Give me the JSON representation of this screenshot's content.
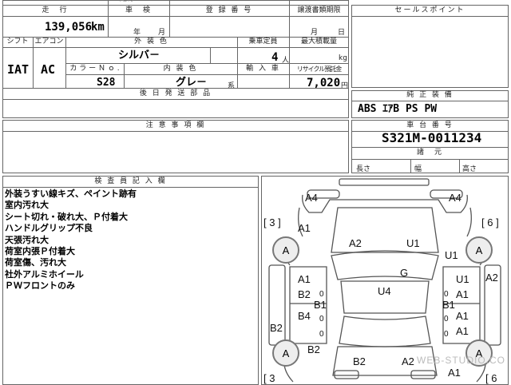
{
  "top_cut_label": "走行",
  "mileage": {
    "label": "走　行",
    "value": "139,056",
    "unit": "km"
  },
  "shaken": {
    "label": "車　検",
    "year_unit": "年",
    "month_unit": "月"
  },
  "registration": {
    "label": "登 録 番 号"
  },
  "transfer": {
    "label": "譲渡書類期限",
    "month_unit": "月",
    "day_unit": "日"
  },
  "sales_point": {
    "label": "セールスポイント"
  },
  "shift": {
    "label": "シフト",
    "value": "IAT"
  },
  "aircon": {
    "label": "エアコン",
    "value": "AC"
  },
  "exterior_color": {
    "label": "外 装 色",
    "value": "シルバ－"
  },
  "capacity": {
    "label": "乗車定員",
    "value": "4",
    "unit": "人"
  },
  "max_load": {
    "label": "最大積載量",
    "unit": "kg"
  },
  "color_no": {
    "label": "カ ラ ー Ｎ ｏ .",
    "value": "S28"
  },
  "interior_color": {
    "label": "内 装 色",
    "value": "グレ－",
    "suffix": "系"
  },
  "import": {
    "label": "輸 入 車"
  },
  "recycle": {
    "label": "リサイクル預託金",
    "value": "7,020",
    "unit": "円"
  },
  "later_items": {
    "label": "後 日 発 送 部 品"
  },
  "factory_options": {
    "label": "純 正 装 備",
    "value": "ABS ｴｱB PS PW"
  },
  "caution": {
    "label": "注 意 事 項 欄"
  },
  "chassis": {
    "label": "車 台 番 号",
    "value": "S321M-0011234"
  },
  "dimensions": {
    "label": "諸　元",
    "length": "長さ",
    "width": "幅",
    "height": "高さ"
  },
  "inspector": {
    "label": "検 査 員 記 入 欄",
    "notes": [
      "外装うすい線キズ、ペイント跡有",
      "室内汚れ大",
      "シート切れ・破れ大、Ｐ付着大",
      "ハンドルグリップ不良",
      "天張汚れ大",
      "荷室内張Ｐ付着大",
      "荷室傷、汚れ大",
      "社外アルミホイール",
      "ＰＷフロントのみ"
    ]
  },
  "diagram": {
    "marks": {
      "a4_left": "A4",
      "a4_right": "A4",
      "bracket3_left": "[ 3 ]",
      "bracket3_left_bottom": "[ 3",
      "bracket6_right": "[ 6 ]",
      "bracket6_right_bottom": "[ 6",
      "a1_fl": "A1",
      "a2_hood": "A2",
      "u1_hood": "U1",
      "u1_right": "U1",
      "a2_right": "A2",
      "g_windshield": "G",
      "a1_ld1": "A1",
      "b2_ld1": "B2",
      "b1_left": "B1",
      "b4_ld2": "B4",
      "b2_left_rear": "B2",
      "b2_lq": "B2",
      "u4_roof": "U4",
      "u1_rd1": "U1",
      "a1_rd1": "A1",
      "b1_right": "B1",
      "a1_rd2": "A1",
      "a1_rq": "A1",
      "b2_rear": "B2",
      "a2_rear": "A2",
      "a1_rear": "A1",
      "wheel_fl": "A",
      "wheel_fr": "A",
      "wheel_rl": "A",
      "wheel_rr": "A",
      "zero_l1": "0",
      "zero_l2": "0",
      "zero_l3": "0",
      "zero_r1": "0",
      "zero_r2": "0",
      "zero_r3": "0"
    },
    "watermark": "WEB-STUDIO.CO"
  }
}
